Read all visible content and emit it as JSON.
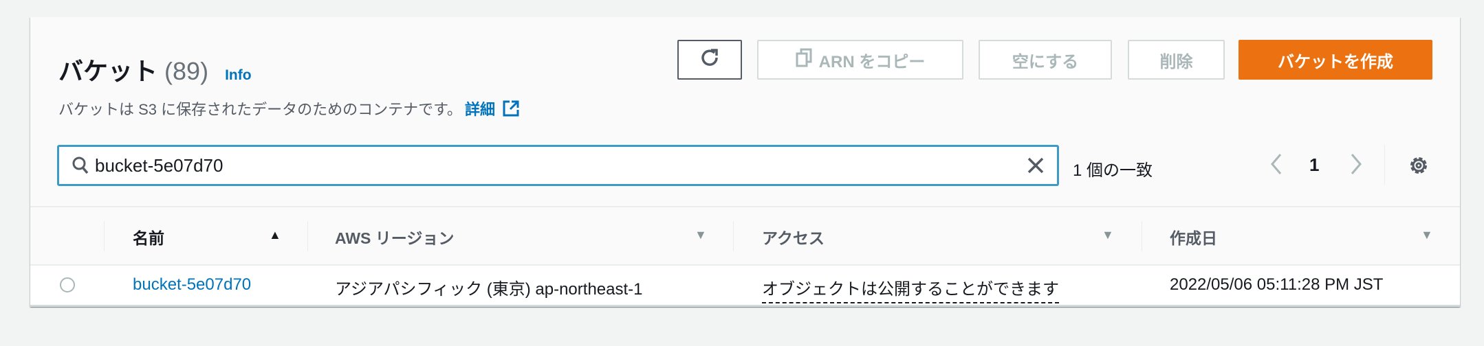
{
  "header": {
    "title": "バケット",
    "count": "(89)",
    "info": "Info",
    "description": "バケットは S3 に保存されたデータのためのコンテナです。",
    "details_link": "詳細"
  },
  "toolbar": {
    "copy_arn": "ARN をコピー",
    "empty": "空にする",
    "delete": "削除",
    "create": "バケットを作成"
  },
  "search": {
    "value": "bucket-5e07d70",
    "match_text": "1 個の一致"
  },
  "pagination": {
    "current_page": "1"
  },
  "table": {
    "columns": [
      {
        "label": "名前",
        "sort": "▲"
      },
      {
        "label": "AWS リージョン",
        "sort": "▼"
      },
      {
        "label": "アクセス",
        "sort": "▼"
      },
      {
        "label": "作成日",
        "sort": "▼"
      }
    ],
    "rows": [
      {
        "name": "bucket-5e07d70",
        "region": "アジアパシフィック (東京) ap-northeast-1",
        "access": "オブジェクトは公開することができます",
        "created": "2022/05/06 05:11:28 PM JST"
      }
    ]
  },
  "colors": {
    "primary": "#ec7211",
    "link": "#0073bb",
    "focus": "#3d9ac4"
  }
}
